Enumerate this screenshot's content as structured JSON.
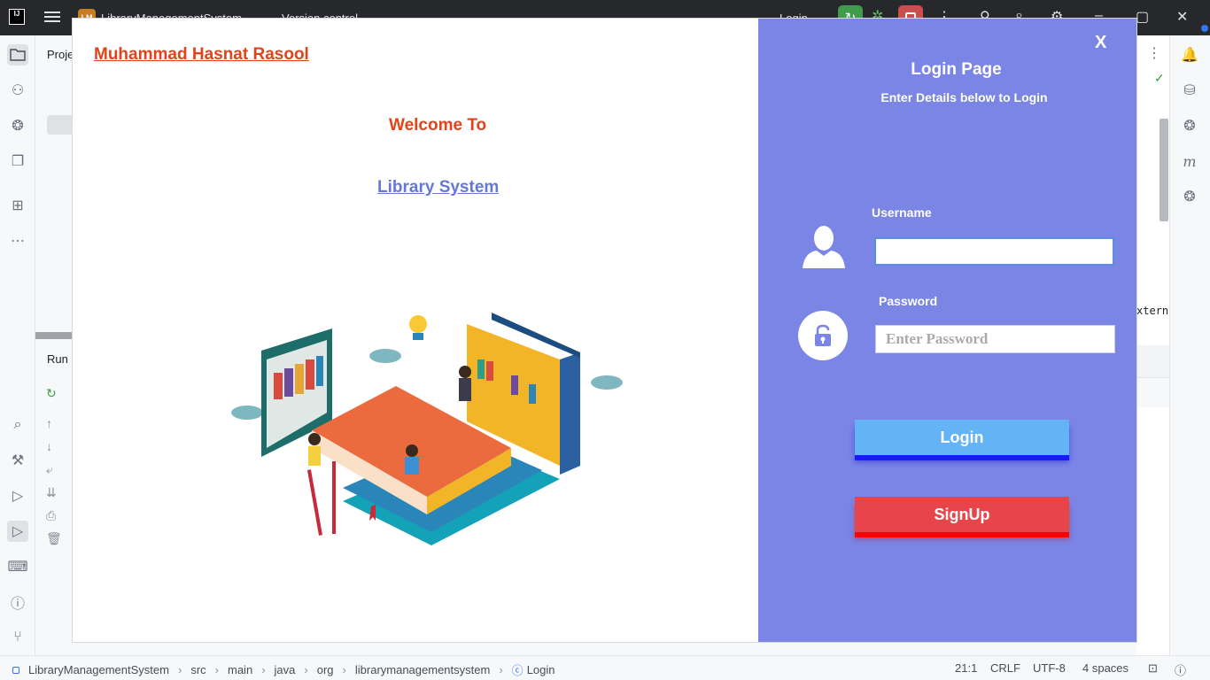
{
  "ide": {
    "logo": "IJ",
    "project_badge": "LM",
    "project_name": "LibraryManagementSystem",
    "version_control": "Version control",
    "run_config": "Login",
    "tool_project_label": "Proje",
    "tool_run_label": "Run",
    "editor_snippet": "xtern"
  },
  "breadcrumb": {
    "items": [
      "LibraryManagementSystem",
      "src",
      "main",
      "java",
      "org",
      "librarymanagementsystem",
      "Login"
    ]
  },
  "status": {
    "position": "21:1",
    "line_sep": "CRLF",
    "encoding": "UTF-8",
    "indent": "4 spaces"
  },
  "app": {
    "author": "Muhammad Hasnat Rasool",
    "welcome": "Welcome To",
    "system_name": "Library System",
    "login": {
      "close": "X",
      "title": "Login Page",
      "subtitle": "Enter Details below to Login",
      "username_label": "Username",
      "username_value": "",
      "password_label": "Password",
      "password_placeholder": "Enter Password",
      "login_button": "Login",
      "signup_button": "SignUp"
    }
  },
  "colors": {
    "panel": "#7a85e6",
    "accent_red": "#e2431a",
    "link_blue": "#6478d8",
    "login_btn": "#64b3f4",
    "signup_btn": "#e8454a"
  }
}
